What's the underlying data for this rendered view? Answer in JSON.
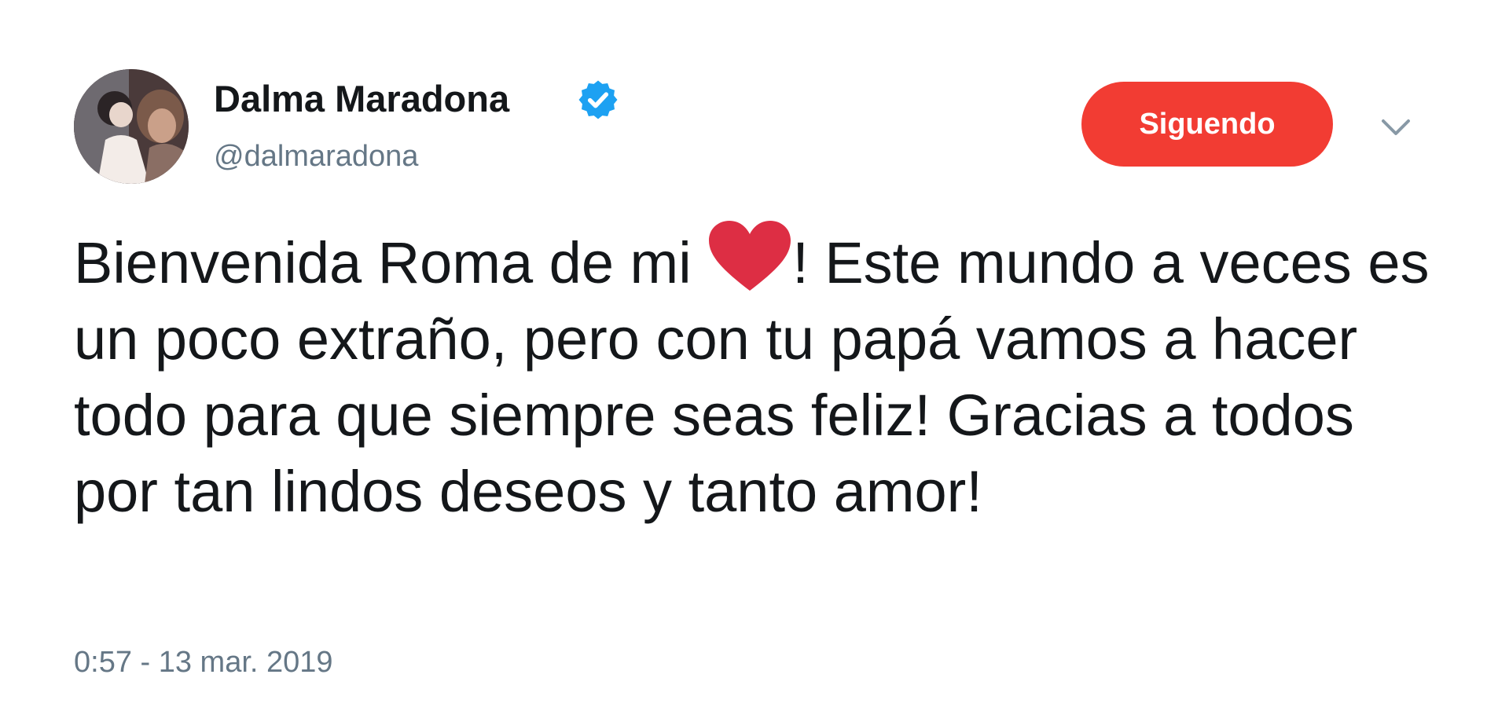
{
  "author": {
    "display_name": "Dalma Maradona",
    "handle": "@dalmaradona",
    "verified": true,
    "avatar_icon": "user-avatar-photo",
    "verified_icon": "verified-badge-icon"
  },
  "actions": {
    "follow_label": "Siguendo",
    "caret_icon": "chevron-down-icon"
  },
  "tweet": {
    "text_before_emoji": "Bienvenida Roma de mi ",
    "emoji_icon": "red-heart-icon",
    "text_after_emoji": "! Este mundo a veces es un poco extraño, pero con tu papá vamos a hacer todo para que siempre seas feliz! Gracias a todos por tan lindos deseos y tanto amor!",
    "timestamp": "0:57 - 13 mar. 2019"
  },
  "colors": {
    "follow_button": "#f23c33",
    "verified": "#1da1f2",
    "heart": "#dd2e44",
    "secondary_text": "#657786",
    "primary_text": "#14171a"
  }
}
